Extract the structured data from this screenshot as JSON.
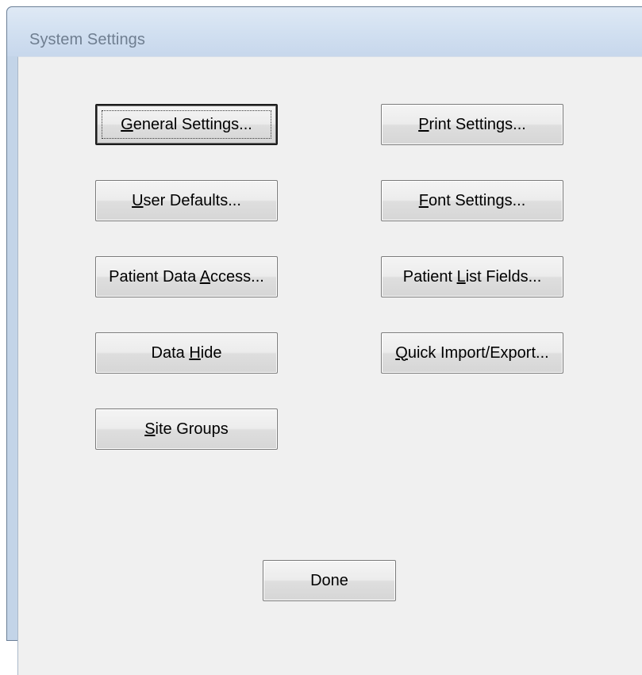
{
  "window": {
    "title": "System Settings"
  },
  "buttons": {
    "general_settings": {
      "before": "",
      "mnemonic": "G",
      "after": "eneral Settings..."
    },
    "print_settings": {
      "before": "",
      "mnemonic": "P",
      "after": "rint Settings..."
    },
    "user_defaults": {
      "before": "",
      "mnemonic": "U",
      "after": "ser Defaults..."
    },
    "font_settings": {
      "before": "",
      "mnemonic": "F",
      "after": "ont Settings..."
    },
    "patient_data_access": {
      "before": "Patient Data ",
      "mnemonic": "A",
      "after": "ccess..."
    },
    "patient_list_fields": {
      "before": "Patient ",
      "mnemonic": "L",
      "after": "ist Fields..."
    },
    "data_hide": {
      "before": "Data ",
      "mnemonic": "H",
      "after": "ide"
    },
    "quick_import_export": {
      "before": "",
      "mnemonic": "Q",
      "after": "uick Import/Export..."
    },
    "site_groups": {
      "before": "",
      "mnemonic": "S",
      "after": "ite Groups"
    },
    "done": {
      "label": "Done"
    }
  }
}
